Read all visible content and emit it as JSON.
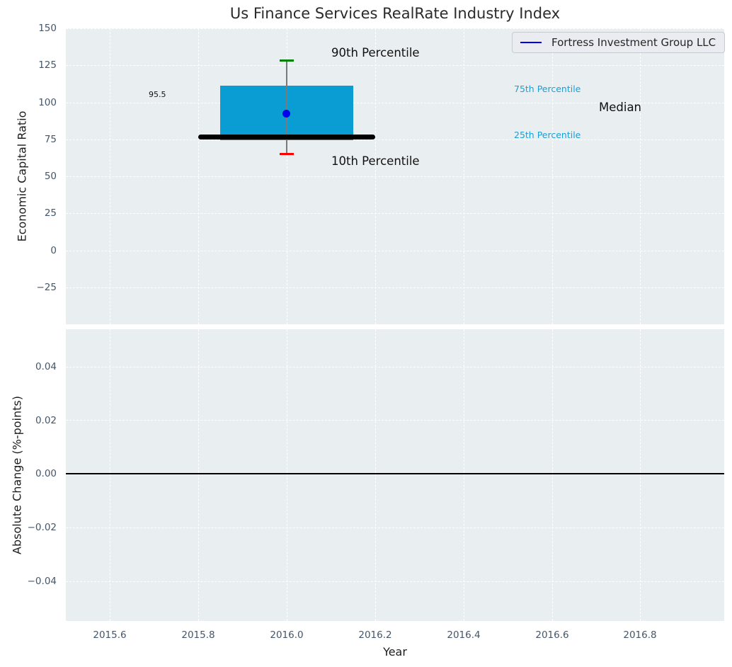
{
  "title": "Us Finance Services RealRate Industry Index",
  "legend": {
    "label": "Fortress Investment Group LLC",
    "line_color": "#0000ee"
  },
  "top_axes": {
    "ylabel": "Economic Capital Ratio",
    "yticks": [
      "150",
      "125",
      "100",
      "75",
      "50",
      "25",
      "0",
      "−25"
    ],
    "labels": {
      "p90": "90th Percentile",
      "p75": "75th Percentile",
      "median": "Median",
      "median_value": "95.5",
      "p25": "25th Percentile",
      "p10": "10th Percentile"
    }
  },
  "bottom_axes": {
    "ylabel": "Absolute Change (%-points)",
    "yticks": [
      "0.04",
      "0.02",
      "0.00",
      "−0.02",
      "−0.04"
    ]
  },
  "xaxis": {
    "label": "Year",
    "ticks": [
      "2015.6",
      "2015.8",
      "2016.0",
      "2016.2",
      "2016.4",
      "2016.6",
      "2016.8"
    ]
  },
  "colors": {
    "box_fill": "#0a9dd4",
    "percentile_label": "#1a9fd6",
    "median_line": "#000000",
    "marker_dot": "#0000ee",
    "p90_cap": "#008000",
    "p10_cap": "#ff0000",
    "axes_background": "#e9eef0"
  },
  "chart_data": [
    {
      "type": "boxplot",
      "title": "Us Finance Services RealRate Industry Index",
      "xlabel": "Year",
      "ylabel": "Economic Capital Ratio",
      "xlim": [
        2015.5,
        2017.0
      ],
      "ylim": [
        -50,
        150
      ],
      "xticks": [
        2015.6,
        2015.8,
        2016.0,
        2016.2,
        2016.4,
        2016.6,
        2016.8
      ],
      "yticks": [
        150,
        125,
        100,
        75,
        50,
        25,
        0,
        -25
      ],
      "grid": true,
      "legend_position": "upper right",
      "series": [
        {
          "name": "Fortress Investment Group LLC",
          "x": [
            2016.0
          ],
          "y": [
            92.3
          ],
          "marker": "dot",
          "color": "#0000ee"
        }
      ],
      "box": {
        "x": 2016.0,
        "p10": 65,
        "p25": 74.5,
        "median": 95.5,
        "p75": 111.5,
        "p90": 128,
        "box_x_span": [
          2015.85,
          2016.15
        ],
        "median_x_span": [
          2015.8,
          2016.2
        ]
      },
      "annotations": [
        {
          "text": "90th Percentile",
          "x": 2016.1,
          "y": 133
        },
        {
          "text": "75th Percentile",
          "x": 2016.52,
          "y": 109
        },
        {
          "text": "Median",
          "x": 2016.71,
          "y": 97
        },
        {
          "text": "95.5",
          "x": 2015.69,
          "y": 105
        },
        {
          "text": "25th Percentile",
          "x": 2016.52,
          "y": 78
        },
        {
          "text": "10th Percentile",
          "x": 2016.1,
          "y": 60
        }
      ]
    },
    {
      "type": "line",
      "xlabel": "Year",
      "ylabel": "Absolute Change (%-points)",
      "xlim": [
        2015.5,
        2017.0
      ],
      "ylim": [
        -0.055,
        0.054
      ],
      "xticks": [
        2015.6,
        2015.8,
        2016.0,
        2016.2,
        2016.4,
        2016.6,
        2016.8
      ],
      "yticks": [
        0.04,
        0.02,
        0.0,
        -0.02,
        -0.04
      ],
      "grid": true,
      "zero_line_y": 0.0,
      "series": []
    }
  ]
}
